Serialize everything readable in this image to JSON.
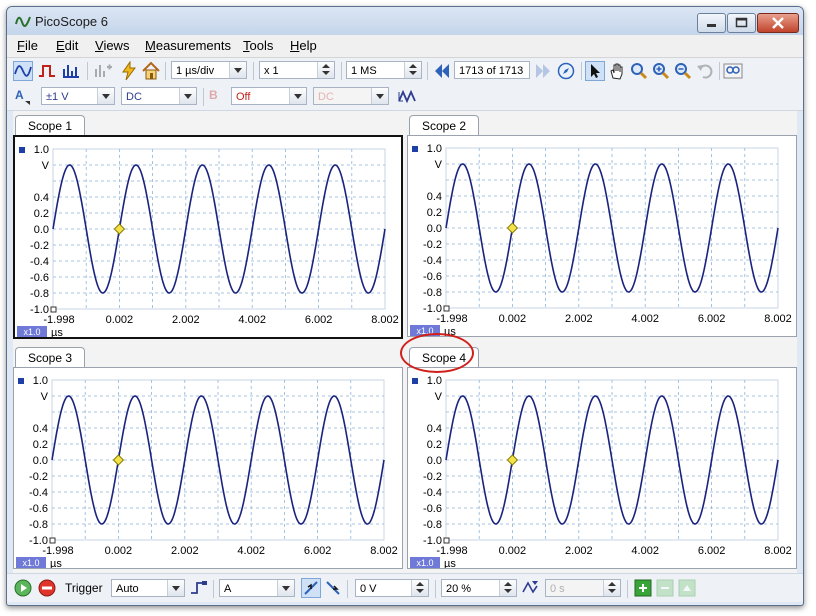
{
  "window": {
    "title": "PicoScope 6"
  },
  "menu": [
    {
      "label": "File",
      "key": "F"
    },
    {
      "label": "Edit",
      "key": "E"
    },
    {
      "label": "Views",
      "key": "V"
    },
    {
      "label": "Measurements",
      "key": "M"
    },
    {
      "label": "Tools",
      "key": "T"
    },
    {
      "label": "Help",
      "key": "H"
    }
  ],
  "toolbar": {
    "timebase": "1 µs/div",
    "zoom": "x 1",
    "samples": "1 MS",
    "buffer_current": "1713",
    "buffer_of": "of 1713"
  },
  "channel": {
    "name": "A",
    "range": "±1 V",
    "coupling": "DC",
    "channel_b": "B",
    "channel_b_state": "Off",
    "channel_b_coupling": "DC"
  },
  "scopes": [
    {
      "title": "Scope 1",
      "active": true
    },
    {
      "title": "Scope 2",
      "active": false
    },
    {
      "title": "Scope 3",
      "active": false
    },
    {
      "title": "Scope 4",
      "active": false,
      "highlighted": true
    }
  ],
  "axis": {
    "y_ticks": [
      "1.0",
      "0.4",
      "0.2",
      "0.0",
      "-0.2",
      "-0.4",
      "-0.6",
      "-0.8",
      "-1.0"
    ],
    "y_unit": "V",
    "x_ticks": [
      "-1.998",
      "0.002",
      "2.002",
      "4.002",
      "6.002",
      "8.002"
    ],
    "x_unit": "µs",
    "zoom_badge": "x1.0"
  },
  "status": {
    "trigger_label": "Trigger",
    "trigger_mode": "Auto",
    "trigger_source": "A",
    "threshold": "0 V",
    "pre_trigger": "20 %",
    "delay": "0 s"
  },
  "colors": {
    "trace": "#1a237e",
    "grid": "#8fb4d9",
    "marker": "#f2e34a",
    "highlight": "#d0201c"
  }
}
